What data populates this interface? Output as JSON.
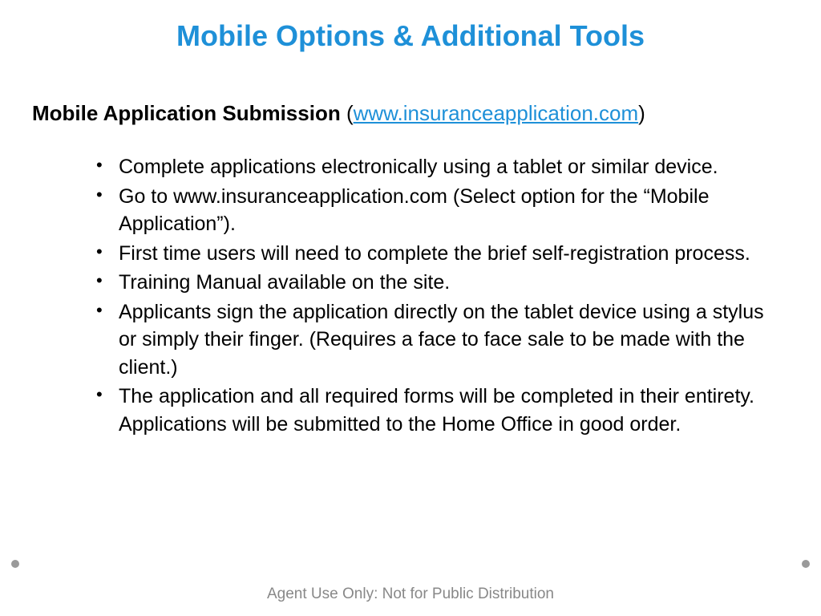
{
  "title": "Mobile Options & Additional Tools",
  "section": {
    "heading_bold": "Mobile Application Submission",
    "heading_paren_open": " (",
    "heading_link": "www.insuranceapplication.com",
    "heading_paren_close": ")"
  },
  "bullets": [
    "Complete applications electronically using a tablet or similar device.",
    "Go to www.insuranceapplication.com (Select option for the “Mobile Application”).",
    "First time users will need to complete the brief self-registration process.",
    "Training Manual available on the site.",
    "Applicants sign the application directly on the tablet device using a stylus or simply their finger. (Requires a face to face sale to be made with the client.)",
    "The application and all required forms will be completed in their entirety. Applications will be submitted to the Home Office in good order."
  ],
  "footer": "Agent Use Only: Not for Public Distribution"
}
